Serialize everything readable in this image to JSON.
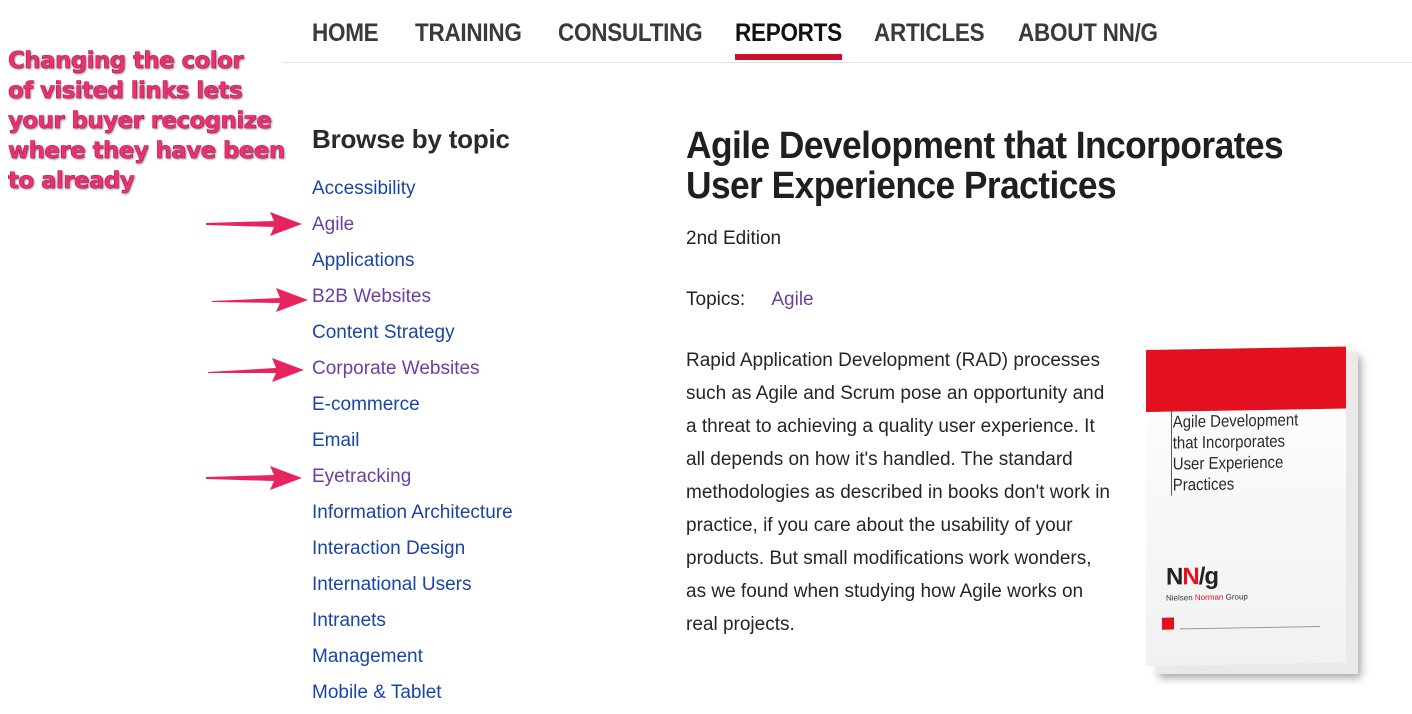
{
  "nav": {
    "items": [
      {
        "label": "HOME",
        "active": false
      },
      {
        "label": "TRAINING",
        "active": false
      },
      {
        "label": "CONSULTING",
        "active": false
      },
      {
        "label": "REPORTS",
        "active": true
      },
      {
        "label": "ARTICLES",
        "active": false
      },
      {
        "label": "ABOUT NN/G",
        "active": false
      }
    ],
    "active_color": "#c8102e"
  },
  "annotation": {
    "lines": [
      "Changing the color",
      "of visited links lets",
      "your buyer recognize",
      "where they have been",
      "to already"
    ],
    "color": "#e8336f"
  },
  "sidebar": {
    "title": "Browse by topic",
    "topics": [
      {
        "label": "Accessibility",
        "visited": false
      },
      {
        "label": "Agile",
        "visited": true
      },
      {
        "label": "Applications",
        "visited": false
      },
      {
        "label": "B2B Websites",
        "visited": true
      },
      {
        "label": "Content Strategy",
        "visited": false
      },
      {
        "label": "Corporate Websites",
        "visited": true
      },
      {
        "label": "E-commerce",
        "visited": false
      },
      {
        "label": "Email",
        "visited": false
      },
      {
        "label": "Eyetracking",
        "visited": true
      },
      {
        "label": "Information Architecture",
        "visited": false
      },
      {
        "label": "Interaction Design",
        "visited": false
      },
      {
        "label": "International Users",
        "visited": false
      },
      {
        "label": "Intranets",
        "visited": false
      },
      {
        "label": "Management",
        "visited": false
      },
      {
        "label": "Mobile & Tablet",
        "visited": false
      }
    ],
    "link_color": "#1a45a8",
    "visited_color": "#6b3fa0"
  },
  "report": {
    "title": "Agile Development that Incorporates User Experience Practices",
    "edition": "2nd Edition",
    "topics_label": "Topics:",
    "topics": [
      "Agile"
    ],
    "description": "Rapid Application Development (RAD) processes such as Agile and Scrum pose an opportunity and a threat to achieving a quality user experience. It all depends on how it's handled. The standard methodologies as described in books don't work in practice, if you care about the usability of your products. But small modifications work wonders, as we found when studying how Agile works on real projects."
  },
  "book": {
    "cover_title": "Agile Development that Incorporates User Experience Practices",
    "logo_n1": "N",
    "logo_n2": "N",
    "logo_g": "/g",
    "logo_sub_1": "Nielsen",
    "logo_sub_2": "Norman",
    "logo_sub_3": "Group",
    "accent_color": "#e3101f"
  }
}
